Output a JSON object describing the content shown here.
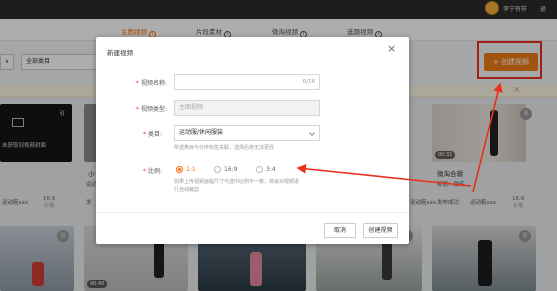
{
  "topbar": {
    "username": "李宁有样",
    "extra": "退"
  },
  "tabs": [
    {
      "label": "主图视频",
      "info": "i"
    },
    {
      "label": "片段素材",
      "info": "i"
    },
    {
      "label": "微淘视频",
      "info": "i"
    },
    {
      "label": "选题视频",
      "info": "i"
    }
  ],
  "filters": {
    "left_select": "∨",
    "category": "全部类目"
  },
  "create_button": "+ 创建视频",
  "notice_close": "×",
  "cards_row1": [
    {
      "cover_text": "未获取到视频封面",
      "badge": "引",
      "caption_a": "运动鞋xxx",
      "stat_value": "16.9",
      "stat_label": "价格"
    },
    {
      "caption_a": "小",
      "caption_b": "运动鞋xxx",
      "caption_c": "发"
    },
    {
      "caption_a": "运动鞋xxx",
      "stat_value": "16.9",
      "stat_label": "价格"
    },
    {
      "duration": "00:31",
      "title": "微淘合辑",
      "sub": "标题：微传",
      "from": "发布成功",
      "owner": "运动鞋xxx",
      "stat_value": "16.9",
      "stat_label": "价格",
      "badge": "引"
    }
  ],
  "cards_row2": [
    {
      "badge": "引"
    },
    {
      "duration": "00:40"
    },
    {
      "badge": "引"
    },
    {
      "badge": "引"
    }
  ],
  "modal": {
    "title": "新建视频",
    "close": "×",
    "name_label": "视频名称:",
    "name_placeholder": "",
    "name_count": "0/16",
    "type_label": "视频类型:",
    "type_value": "主图视频",
    "category_label": "类目:",
    "category_value": "运动服/休闲服装",
    "category_hint": "所选类目与分辨标签关联，选择后将无法更改",
    "ratio_label": "比例:",
    "ratios": [
      "1:1",
      "16:9",
      "3:4"
    ],
    "ratio_hint_1": "如果上传视频画幅尺寸与选中比例不一致，将会对视频进",
    "ratio_hint_2": "行自动裁剪",
    "cancel": "取消",
    "confirm": "创建视频"
  },
  "colors": {
    "accent": "#ff6a00",
    "button_orange": "#ee7d16",
    "highlight_red": "#e8321e"
  }
}
